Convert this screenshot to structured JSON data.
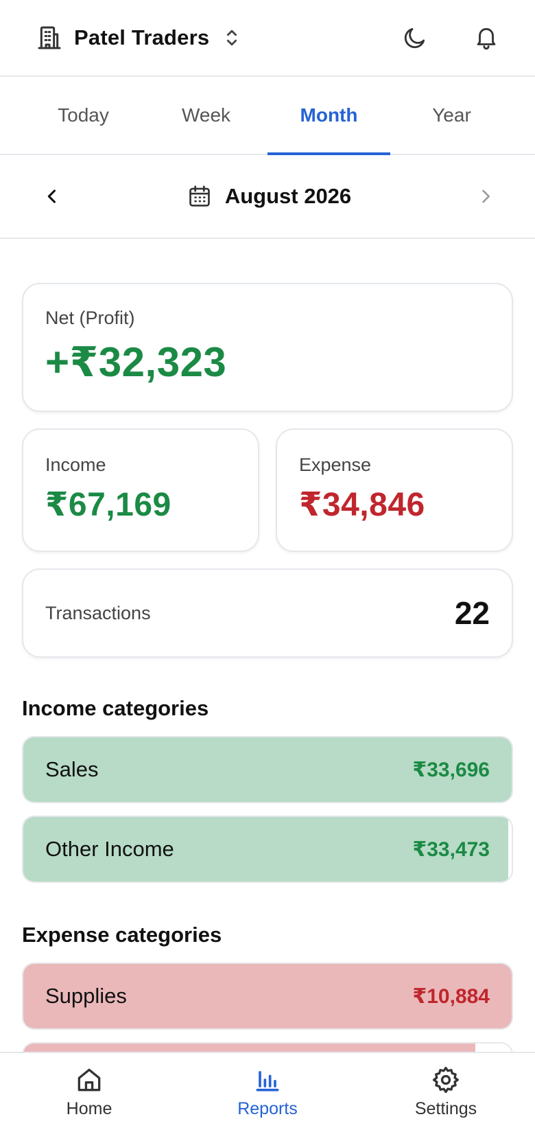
{
  "header": {
    "business_name": "Patel Traders",
    "icons": [
      "building-icon",
      "chevron-up-down-icon",
      "moon-icon",
      "bell-icon"
    ]
  },
  "tabs": [
    {
      "label": "Today",
      "active": false
    },
    {
      "label": "Week",
      "active": false
    },
    {
      "label": "Month",
      "active": true
    },
    {
      "label": "Year",
      "active": false
    }
  ],
  "period": {
    "label": "August 2026"
  },
  "summary": {
    "net_label": "Net (Profit)",
    "net_value": "+₹32,323",
    "income_label": "Income",
    "income_value": "₹67,169",
    "expense_label": "Expense",
    "expense_value": "₹34,846",
    "transactions_label": "Transactions",
    "transactions_value": "22"
  },
  "income_categories": {
    "title": "Income categories",
    "items": [
      {
        "name": "Sales",
        "amount": "₹33,696",
        "share": 1.0
      },
      {
        "name": "Other Income",
        "amount": "₹33,473",
        "share": 0.993
      }
    ]
  },
  "expense_categories": {
    "title": "Expense categories",
    "items": [
      {
        "name": "Supplies",
        "amount": "₹10,884",
        "share": 1.0
      },
      {
        "name": "",
        "amount": "",
        "share": 0.925
      }
    ]
  },
  "bottom_nav": [
    {
      "label": "Home",
      "active": false
    },
    {
      "label": "Reports",
      "active": true
    },
    {
      "label": "Settings",
      "active": false
    }
  ],
  "colors": {
    "accent": "#2563d6",
    "income": "#1b8a45",
    "expense": "#c0262d",
    "income_fill": "#b7dbc6",
    "expense_fill": "#eab8b9"
  }
}
